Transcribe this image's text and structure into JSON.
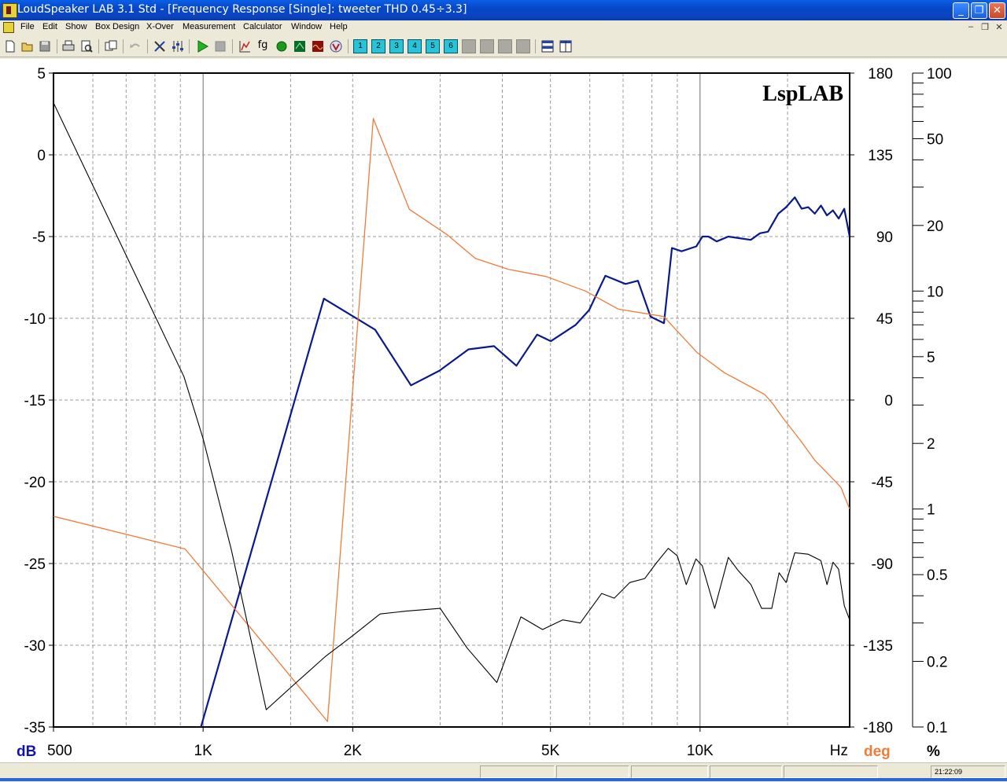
{
  "window": {
    "title": "LoudSpeaker LAB 3.1 Std - [Frequency Response [Single]: tweeter THD 0.45÷3.3]",
    "minimize": "_",
    "restore": "❐",
    "close": "✕"
  },
  "menu": {
    "items": [
      {
        "id": "file",
        "label": "File"
      },
      {
        "id": "edit",
        "label": "Edit"
      },
      {
        "id": "show",
        "label": "Show"
      },
      {
        "id": "box-design",
        "label": "Box Design"
      },
      {
        "id": "x-over",
        "label": "X-Over"
      },
      {
        "id": "measurement",
        "label": "Measurement"
      },
      {
        "id": "calculator",
        "label": "Calculator"
      },
      {
        "id": "window",
        "label": "Window"
      },
      {
        "id": "help",
        "label": "Help"
      }
    ],
    "mdi_controls": [
      "–",
      "❐",
      "✕"
    ]
  },
  "toolbar": {
    "buttons": [
      "new",
      "open",
      "save",
      "print",
      "print-preview",
      "copy",
      "undo",
      "tools",
      "mixer",
      "play",
      "stop",
      "graph-lin",
      "fg",
      "green-dot",
      "scope",
      "spectrum",
      "v-meter"
    ],
    "preset_labels": [
      "1",
      "2",
      "3",
      "4",
      "5",
      "6"
    ],
    "fg_label": "fg"
  },
  "chart": {
    "watermark": "LspLAB",
    "axis_left_unit": "dB",
    "axis_right_unit": "deg",
    "axis_pct_unit": "%",
    "x_unit": "Hz",
    "colors": {
      "magnitude": "#0a1a8c",
      "phase": "#f07a3a",
      "distortion": "#000000",
      "grid": "#9a9a9a",
      "left_axis_label": "#1414a8",
      "right_axis_label": "#f07a3a"
    }
  },
  "chart_data": {
    "type": "line",
    "x_scale": "log",
    "xlim": [
      500,
      20000
    ],
    "x_ticks": [
      {
        "v": 500,
        "label": "500"
      },
      {
        "v": 1000,
        "label": "1K"
      },
      {
        "v": 2000,
        "label": "2K"
      },
      {
        "v": 5000,
        "label": "5K"
      },
      {
        "v": 10000,
        "label": "10K"
      }
    ],
    "ylim_db": [
      -35,
      5
    ],
    "y_db_ticks": [
      5,
      0,
      -5,
      -10,
      -15,
      -20,
      -25,
      -30,
      -35
    ],
    "ylim_deg": [
      -180,
      180
    ],
    "y_deg_ticks": [
      180,
      135,
      90,
      45,
      0,
      -45,
      -90,
      -135,
      -180
    ],
    "pct_scale": "log",
    "ylim_pct": [
      0.1,
      100
    ],
    "y_pct_ticks": [
      {
        "v": 100,
        "label": "100"
      },
      {
        "v": 50,
        "label": "50"
      },
      {
        "v": 20,
        "label": "20"
      },
      {
        "v": 10,
        "label": "10"
      },
      {
        "v": 5,
        "label": "5"
      },
      {
        "v": 2,
        "label": "2"
      },
      {
        "v": 1,
        "label": "1"
      },
      {
        "v": 0.5,
        "label": "0.5"
      },
      {
        "v": 0.2,
        "label": "0.2"
      },
      {
        "v": 0.1,
        "label": "0.1"
      }
    ],
    "series": [
      {
        "axis": "db",
        "points": [
          [
            990,
            -35
          ],
          [
            1750,
            -8.8
          ],
          [
            2220,
            -10.7
          ],
          [
            2620,
            -14.1
          ],
          [
            2990,
            -13.2
          ],
          [
            3420,
            -11.9
          ],
          [
            3850,
            -11.7
          ],
          [
            4270,
            -12.9
          ],
          [
            4700,
            -11.0
          ],
          [
            5010,
            -11.4
          ],
          [
            5620,
            -10.4
          ],
          [
            5980,
            -9.5
          ],
          [
            6450,
            -7.4
          ],
          [
            7080,
            -7.9
          ],
          [
            7500,
            -7.7
          ],
          [
            7950,
            -9.9
          ],
          [
            8460,
            -10.3
          ],
          [
            8780,
            -5.7
          ],
          [
            9180,
            -5.9
          ],
          [
            9830,
            -5.6
          ],
          [
            10110,
            -5.0
          ],
          [
            10400,
            -5.0
          ],
          [
            10800,
            -5.3
          ],
          [
            11400,
            -5.0
          ],
          [
            12010,
            -5.1
          ],
          [
            12650,
            -5.2
          ],
          [
            13200,
            -4.8
          ],
          [
            13700,
            -4.7
          ],
          [
            14370,
            -3.6
          ],
          [
            14900,
            -3.2
          ],
          [
            15510,
            -2.6
          ],
          [
            16010,
            -3.3
          ],
          [
            16510,
            -3.2
          ],
          [
            17020,
            -3.6
          ],
          [
            17510,
            -3.1
          ],
          [
            18000,
            -3.7
          ],
          [
            18510,
            -3.4
          ],
          [
            19010,
            -3.9
          ],
          [
            19500,
            -3.3
          ],
          [
            20000,
            -5.0
          ],
          [
            20500,
            -5.3
          ]
        ]
      },
      {
        "axis": "deg",
        "points": [
          [
            500,
            -64
          ],
          [
            920,
            -82
          ],
          [
            1360,
            -138
          ],
          [
            1780,
            -177
          ],
          [
            2200,
            155
          ],
          [
            2600,
            105
          ],
          [
            3100,
            91
          ],
          [
            3530,
            78
          ],
          [
            4110,
            72
          ],
          [
            4900,
            68
          ],
          [
            5880,
            60
          ],
          [
            6850,
            50
          ],
          [
            8450,
            46
          ],
          [
            9880,
            26
          ],
          [
            11200,
            15
          ],
          [
            12500,
            8
          ],
          [
            13500,
            3
          ],
          [
            14000,
            -2
          ],
          [
            14700,
            -10
          ],
          [
            16000,
            -23
          ],
          [
            17000,
            -33
          ],
          [
            18000,
            -40
          ],
          [
            19200,
            -48
          ],
          [
            20000,
            -60
          ]
        ]
      },
      {
        "axis": "pct",
        "points": [
          [
            500,
            73
          ],
          [
            915,
            4.05
          ],
          [
            1000,
            2.1
          ],
          [
            1140,
            0.65
          ],
          [
            1340,
            0.12
          ],
          [
            1540,
            0.16
          ],
          [
            1760,
            0.21
          ],
          [
            1990,
            0.26
          ],
          [
            2270,
            0.33
          ],
          [
            2560,
            0.34
          ],
          [
            3000,
            0.35
          ],
          [
            3400,
            0.23
          ],
          [
            3900,
            0.16
          ],
          [
            4360,
            0.32
          ],
          [
            4820,
            0.28
          ],
          [
            5290,
            0.31
          ],
          [
            5740,
            0.3
          ],
          [
            6340,
            0.41
          ],
          [
            6720,
            0.39
          ],
          [
            7220,
            0.46
          ],
          [
            7740,
            0.48
          ],
          [
            8140,
            0.56
          ],
          [
            8630,
            0.66
          ],
          [
            9000,
            0.61
          ],
          [
            9380,
            0.45
          ],
          [
            9810,
            0.59
          ],
          [
            10100,
            0.55
          ],
          [
            10700,
            0.35
          ],
          [
            11400,
            0.6
          ],
          [
            11950,
            0.52
          ],
          [
            12660,
            0.45
          ],
          [
            13300,
            0.35
          ],
          [
            13940,
            0.35
          ],
          [
            14420,
            0.51
          ],
          [
            14900,
            0.46
          ],
          [
            15510,
            0.63
          ],
          [
            16510,
            0.62
          ],
          [
            17500,
            0.58
          ],
          [
            18010,
            0.45
          ],
          [
            18520,
            0.57
          ],
          [
            19000,
            0.53
          ],
          [
            19510,
            0.36
          ],
          [
            20000,
            0.31
          ]
        ]
      }
    ]
  },
  "status": {
    "time": "21:22:09"
  }
}
